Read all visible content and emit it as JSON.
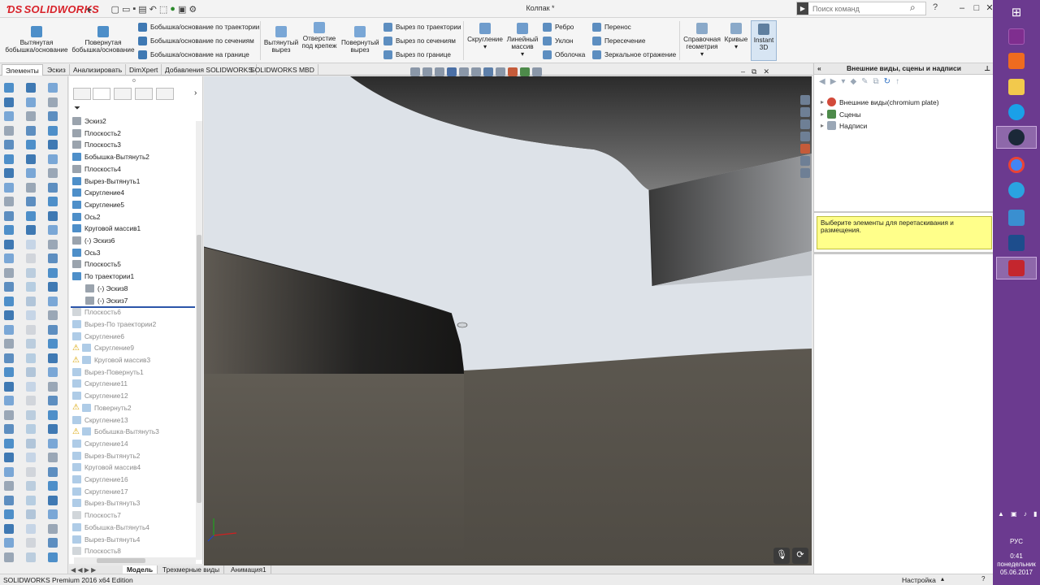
{
  "app": {
    "brand": "SOLIDWORKS",
    "doc_title": "Колпак *",
    "search_placeholder": "Поиск команд"
  },
  "ribbon": {
    "extruded_boss": "Вытянутая бобышка/основание",
    "revolved_boss": "Повернутая бобышка/основание",
    "swept_boss": "Бобышка/основание по траектории",
    "lofted_boss": "Бобышка/основание по сечениям",
    "boundary_boss": "Бобышка/основание на границе",
    "extruded_cut": "Вытянутый вырез",
    "hole_wizard": "Отверстие под крепеж",
    "revolved_cut": "Повернутый вырез",
    "swept_cut": "Вырез по траектории",
    "lofted_cut": "Вырез по сечениям",
    "boundary_cut": "Вырез по границе",
    "fillet": "Скругление",
    "linear_pattern": "Линейный массив",
    "rib": "Ребро",
    "draft": "Уклон",
    "shell": "Оболочка",
    "wrap": "Перенос",
    "intersect": "Пересечение",
    "mirror": "Зеркальное отражение",
    "reference_geometry": "Справочная геометрия",
    "curves": "Кривые",
    "instant3d": "Instant 3D"
  },
  "tabs": [
    "Элементы",
    "Эскиз",
    "Анализировать",
    "DimXpert",
    "Добавления SOLIDWORKS",
    "SOLIDWORKS MBD"
  ],
  "tree": {
    "items": [
      {
        "label": "Эскиз2",
        "dim": false,
        "warn": false
      },
      {
        "label": "Плоскость2",
        "dim": false,
        "warn": false
      },
      {
        "label": "Плоскость3",
        "dim": false,
        "warn": false
      },
      {
        "label": "Бобышка-Вытянуть2",
        "dim": false,
        "warn": false
      },
      {
        "label": "Плоскость4",
        "dim": false,
        "warn": false
      },
      {
        "label": "Вырез-Вытянуть1",
        "dim": false,
        "warn": false
      },
      {
        "label": "Скругление4",
        "dim": false,
        "warn": false
      },
      {
        "label": "Скругление5",
        "dim": false,
        "warn": false
      },
      {
        "label": "Ось2",
        "dim": false,
        "warn": false
      },
      {
        "label": "Круговой массив1",
        "dim": false,
        "warn": false
      },
      {
        "label": "(-) Эскиз6",
        "dim": false,
        "warn": false
      },
      {
        "label": "Ось3",
        "dim": false,
        "warn": false
      },
      {
        "label": "Плоскость5",
        "dim": false,
        "warn": false
      },
      {
        "label": "По траектории1",
        "dim": false,
        "warn": false
      },
      {
        "label": "(-) Эскиз8",
        "dim": false,
        "warn": false
      },
      {
        "label": "(-) Эскиз7",
        "dim": false,
        "warn": false
      },
      {
        "label": "Плоскость6",
        "dim": true,
        "warn": false
      },
      {
        "label": "Вырез-По траектории2",
        "dim": true,
        "warn": false
      },
      {
        "label": "Скругление6",
        "dim": true,
        "warn": false
      },
      {
        "label": "Скругление9",
        "dim": true,
        "warn": true
      },
      {
        "label": "Круговой массив3",
        "dim": true,
        "warn": true
      },
      {
        "label": "Вырез-Повернуть1",
        "dim": true,
        "warn": false
      },
      {
        "label": "Скругление11",
        "dim": true,
        "warn": false
      },
      {
        "label": "Скругление12",
        "dim": true,
        "warn": false
      },
      {
        "label": "Повернуть2",
        "dim": true,
        "warn": true
      },
      {
        "label": "Скругление13",
        "dim": true,
        "warn": false
      },
      {
        "label": "Бобышка-Вытянуть3",
        "dim": true,
        "warn": true
      },
      {
        "label": "Скругление14",
        "dim": true,
        "warn": false
      },
      {
        "label": "Вырез-Вытянуть2",
        "dim": true,
        "warn": false
      },
      {
        "label": "Круговой массив4",
        "dim": true,
        "warn": false
      },
      {
        "label": "Скругление16",
        "dim": true,
        "warn": false
      },
      {
        "label": "Скругление17",
        "dim": true,
        "warn": false
      },
      {
        "label": "Вырез-Вытянуть3",
        "dim": true,
        "warn": false
      },
      {
        "label": "Плоскость7",
        "dim": true,
        "warn": false
      },
      {
        "label": "Бобышка-Вытянуть4",
        "dim": true,
        "warn": false
      },
      {
        "label": "Вырез-Вытянуть4",
        "dim": true,
        "warn": false
      },
      {
        "label": "Плоскость8",
        "dim": true,
        "warn": false
      }
    ]
  },
  "right_panel": {
    "title": "Внешние виды, сцены и надписи",
    "items": [
      "Внешние виды(chromium plate)",
      "Сцены",
      "Надписи"
    ],
    "tip": "Выберите элементы для перетаскивания и размещения."
  },
  "bottom_tabs": [
    "Модель",
    "Трехмерные виды",
    "Анимация1"
  ],
  "status": {
    "edition": "SOLIDWORKS Premium 2016 x64 Edition",
    "settings": "Настройка"
  },
  "taskbar": {
    "lang": "РУС",
    "time": "0:41",
    "day": "понедельник",
    "date": "05.06.2017",
    "apps": [
      "windows-icon",
      "winrar-icon",
      "mi-icon",
      "explorer-icon",
      "skype-icon",
      "steam-icon",
      "chrome-icon",
      "telegram-icon",
      "control-panel-icon",
      "monitor-icon",
      "solidworks-icon"
    ]
  },
  "colors": {
    "taskbar": "#6b3a8f",
    "accent": "#2b55a9",
    "tip": "#ffff8a"
  }
}
